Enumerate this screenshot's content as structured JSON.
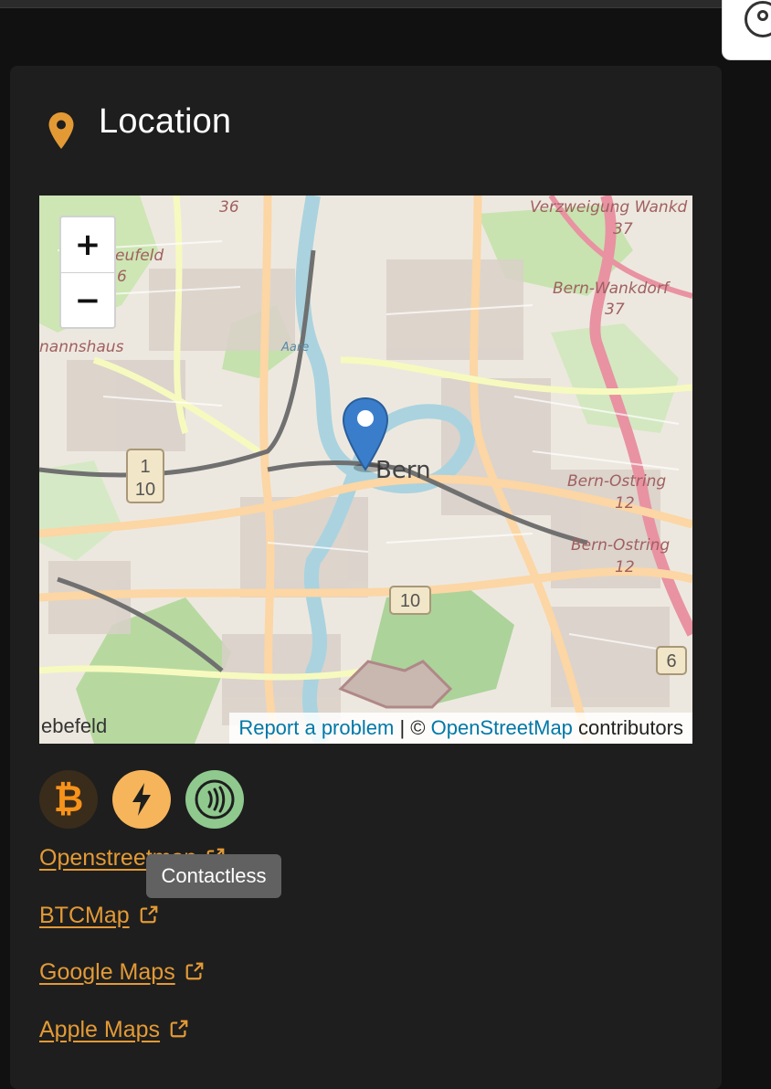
{
  "header": {
    "title": "Location",
    "accent": "#e39a35"
  },
  "map": {
    "labels": {
      "bern": "Bern",
      "wankdorf_top": "Verzweigung Wankd",
      "wankdorf": "Bern-Wankdorf",
      "ostring1": "Bern-Ostring",
      "ostring2": "Bern-Ostring",
      "aare": "Aare",
      "neufeld": "eufeld",
      "mannshaus": "nannshaus",
      "ebefeld": "ebefeld",
      "route_36": "36",
      "route_37a": "37",
      "route_37b": "37",
      "route_12a": "12",
      "route_12b": "12",
      "shield_1_10": "1",
      "shield_10a": "10",
      "shield_10b": "10",
      "shield_6": "6",
      "route_6small": "6"
    },
    "zoom_in": "+",
    "zoom_out": "−",
    "attribution": {
      "report": "Report a problem",
      "separator": "| ©",
      "osm": "OpenStreetMap",
      "contributors": "contributors"
    }
  },
  "payments": {
    "btc_symbol": "₿",
    "icons": [
      "bitcoin-icon",
      "lightning-icon",
      "contactless-icon"
    ]
  },
  "links": [
    {
      "label": "Openstreetmap"
    },
    {
      "label": "BTCMap"
    },
    {
      "label": "Google Maps"
    },
    {
      "label": "Apple Maps"
    }
  ],
  "tooltip": "Contactless"
}
